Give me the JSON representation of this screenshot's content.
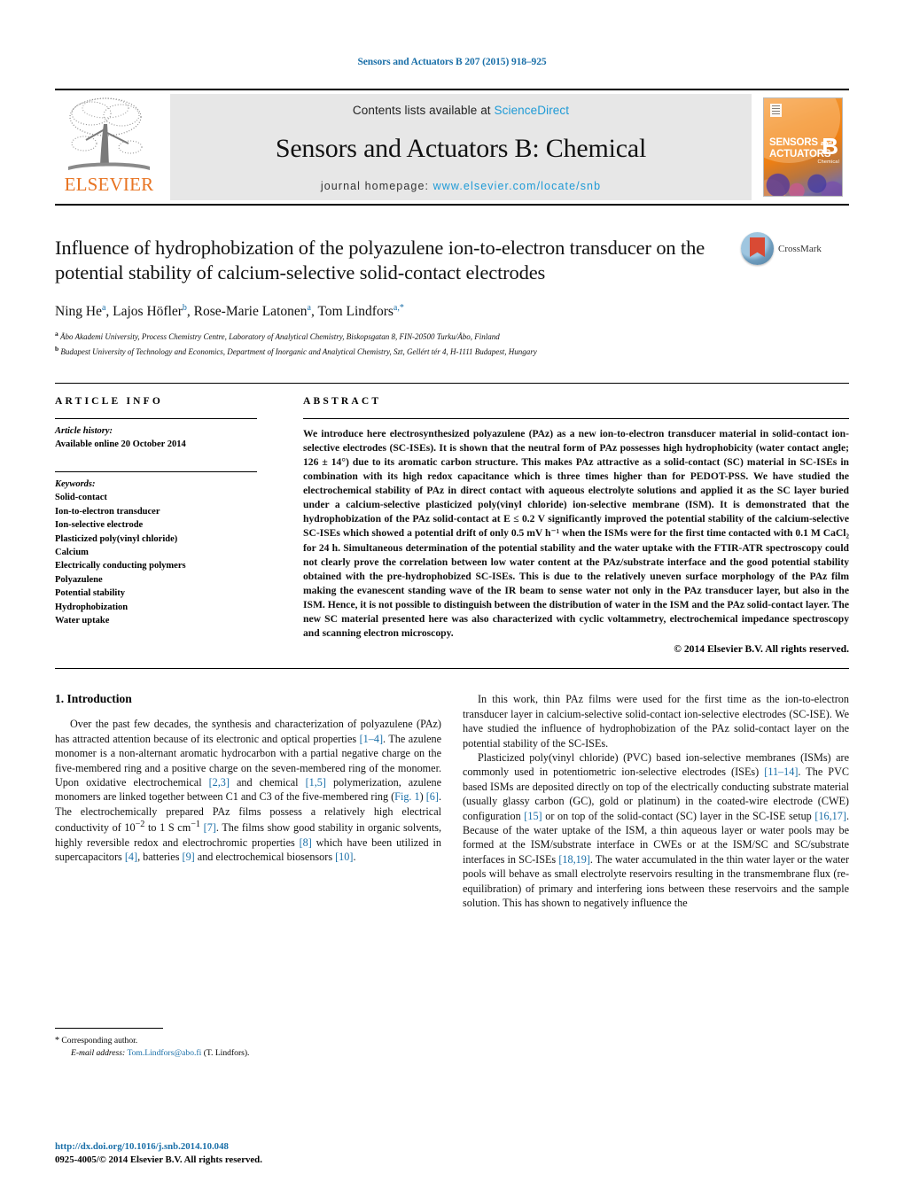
{
  "running_head": "Sensors and Actuators B 207 (2015) 918–925",
  "masthead": {
    "publisher_name": "ELSEVIER",
    "contents_prefix": "Contents lists available at ",
    "sciencedirect": "ScienceDirect",
    "journal_title": "Sensors and Actuators B: Chemical",
    "homepage_label": "journal homepage: ",
    "homepage_url": "www.elsevier.com/locate/snb",
    "cover": {
      "line1": "SENSORS",
      "line1_suffix": "and",
      "line2": "ACTUATORS",
      "letter": "B",
      "sub": "Chemical"
    }
  },
  "crossmark": {
    "label": "CrossMark"
  },
  "article": {
    "title": "Influence of hydrophobization of the polyazulene ion-to-electron transducer on the potential stability of calcium-selective solid-contact electrodes",
    "authors_html": "Ning He<sup>a</sup>, Lajos Höfler<sup>b</sup>, Rose-Marie Latonen<sup>a</sup>, Tom Lindfors<sup>a,*</sup>",
    "affiliations": [
      {
        "marker": "a",
        "text": "Åbo Akademi University, Process Chemistry Centre, Laboratory of Analytical Chemistry, Biskopsgatan 8, FIN-20500 Turku/Åbo, Finland"
      },
      {
        "marker": "b",
        "text": "Budapest University of Technology and Economics, Department of Inorganic and Analytical Chemistry, Szt, Gellért tér 4, H-1111 Budapest, Hungary"
      }
    ]
  },
  "article_info": {
    "heading": "ARTICLE INFO",
    "history_label": "Article history:",
    "history_value": "Available online 20 October 2014",
    "keywords_label": "Keywords:",
    "keywords": [
      "Solid-contact",
      "Ion-to-electron transducer",
      "Ion-selective electrode",
      "Plasticized poly(vinyl chloride)",
      "Calcium",
      "Electrically conducting polymers",
      "Polyazulene",
      "Potential stability",
      "Hydrophobization",
      "Water uptake"
    ]
  },
  "abstract": {
    "heading": "ABSTRACT",
    "text": "We introduce here electrosynthesized polyazulene (PAz) as a new ion-to-electron transducer material in solid-contact ion-selective electrodes (SC-ISEs). It is shown that the neutral form of PAz possesses high hydrophobicity (water contact angle; 126 ± 14°) due to its aromatic carbon structure. This makes PAz attractive as a solid-contact (SC) material in SC-ISEs in combination with its high redox capacitance which is three times higher than for PEDOT-PSS. We have studied the electrochemical stability of PAz in direct contact with aqueous electrolyte solutions and applied it as the SC layer buried under a calcium-selective plasticized poly(vinyl chloride) ion-selective membrane (ISM). It is demonstrated that the hydrophobization of the PAz solid-contact at E ≤ 0.2 V significantly improved the potential stability of the calcium-selective SC-ISEs which showed a potential drift of only 0.5 mV h⁻¹ when the ISMs were for the first time contacted with 0.1 M CaCl₂ for 24 h. Simultaneous determination of the potential stability and the water uptake with the FTIR-ATR spectroscopy could not clearly prove the correlation between low water content at the PAz/substrate interface and the good potential stability obtained with the pre-hydrophobized SC-ISEs. This is due to the relatively uneven surface morphology of the PAz film making the evanescent standing wave of the IR beam to sense water not only in the PAz transducer layer, but also in the ISM. Hence, it is not possible to distinguish between the distribution of water in the ISM and the PAz solid-contact layer. The new SC material presented here was also characterized with cyclic voltammetry, electrochemical impedance spectroscopy and scanning electron microscopy.",
    "copyright": "© 2014 Elsevier B.V. All rights reserved."
  },
  "introduction": {
    "heading": "1. Introduction",
    "left_paragraph_1_html": "Over the past few decades, the synthesis and characterization of polyazulene (PAz) has attracted attention because of its electronic and optical properties <span class=\"ref\">[1–4]</span>. The azulene monomer is a non-alternant aromatic hydrocarbon with a partial negative charge on the five-membered ring and a positive charge on the seven-membered ring of the monomer. Upon oxidative electrochemical <span class=\"ref\">[2,3]</span> and chemical <span class=\"ref\">[1,5]</span> polymerization, azulene monomers are linked together between C1 and C3 of the five-membered ring (<span class=\"ref\">Fig. 1</span>) <span class=\"ref\">[6]</span>. The electrochemically prepared PAz films possess a relatively high electrical conductivity of 10<sup>−2</sup> to 1 S cm<sup>−1</sup> <span class=\"ref\">[7]</span>. The films show good stability in organic solvents, highly reversible redox and electrochromic properties <span class=\"ref\">[8]</span> which have been utilized in supercapacitors <span class=\"ref\">[4]</span>, batteries <span class=\"ref\">[9]</span> and electrochemical biosensors <span class=\"ref\">[10]</span>.",
    "right_paragraph_1_html": "In this work, thin PAz films were used for the first time as the ion-to-electron transducer layer in calcium-selective solid-contact ion-selective electrodes (SC-ISE). We have studied the influence of hydrophobization of the PAz solid-contact layer on the potential stability of the SC-ISEs.",
    "right_paragraph_2_html": "Plasticized poly(vinyl chloride) (PVC) based ion-selective membranes (ISMs) are commonly used in potentiometric ion-selective electrodes (ISEs) <span class=\"ref\">[11–14]</span>. The PVC based ISMs are deposited directly on top of the electrically conducting substrate material (usually glassy carbon (GC), gold or platinum) in the coated-wire electrode (CWE) configuration <span class=\"ref\">[15]</span> or on top of the solid-contact (SC) layer in the SC-ISE setup <span class=\"ref\">[16,17]</span>. Because of the water uptake of the ISM, a thin aqueous layer or water pools may be formed at the ISM/substrate interface in CWEs or at the ISM/SC and SC/substrate interfaces in SC-ISEs <span class=\"ref\">[18,19]</span>. The water accumulated in the thin water layer or the water pools will behave as small electrolyte reservoirs resulting in the transmembrane flux (re-equilibration) of primary and interfering ions between these reservoirs and the sample solution. This has shown to negatively influence the"
  },
  "footnote": {
    "corresponding_marker": "*",
    "corresponding_text": "Corresponding author.",
    "email_label": "E-mail address:",
    "email": "Tom.Lindfors@abo.fi",
    "email_suffix": "(T. Lindfors)."
  },
  "footer": {
    "doi": "http://dx.doi.org/10.1016/j.snb.2014.10.048",
    "issn_copyright": "0925-4005/© 2014 Elsevier B.V. All rights reserved."
  },
  "colors": {
    "link_blue": "#1a6fa8",
    "sciencedirect_blue": "#1e9ad6",
    "elsevier_orange": "#E87422",
    "masthead_grey": "#e7e7e7"
  }
}
